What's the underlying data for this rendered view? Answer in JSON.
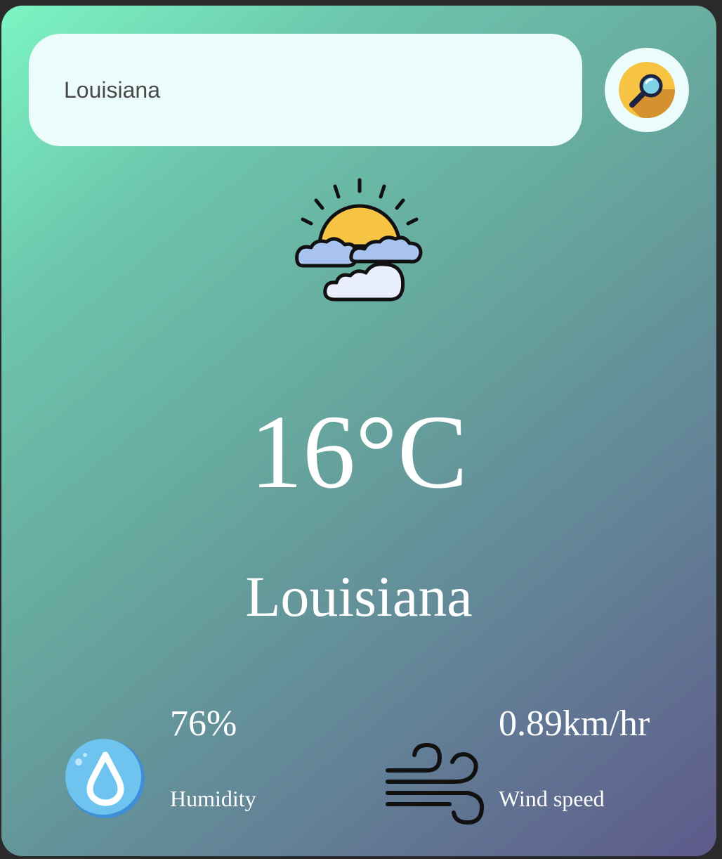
{
  "search": {
    "value": "Louisiana",
    "icon": "search-magnifier-icon"
  },
  "weather": {
    "icon": "partly-cloudy-sun-icon",
    "temperature": "16°C",
    "city": "Louisiana"
  },
  "humidity": {
    "value": "76%",
    "label": "Humidity",
    "icon": "water-drop-icon"
  },
  "wind": {
    "value": "0.89km/hr",
    "label": "Wind speed",
    "icon": "wind-icon"
  },
  "colors": {
    "gradient_start": "#7bf5c3",
    "gradient_end": "#5e5a8a",
    "search_bg": "#ebfcfa",
    "text": "#ffffff"
  }
}
